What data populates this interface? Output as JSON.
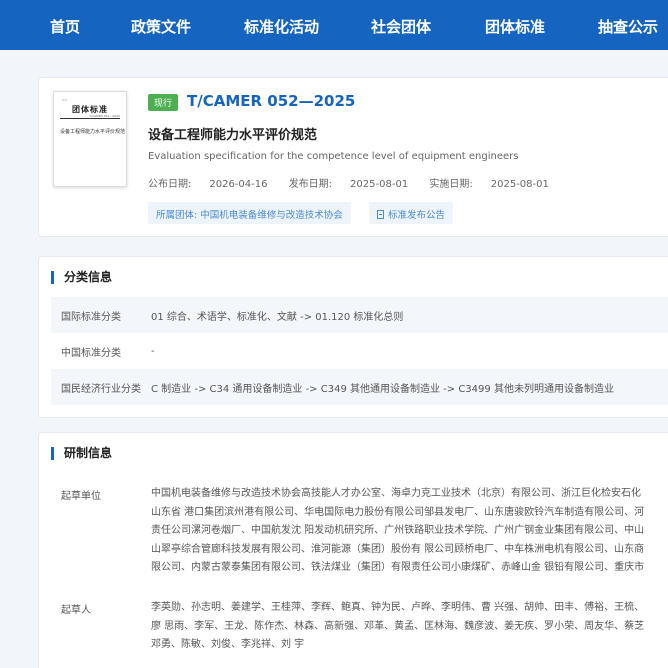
{
  "nav": {
    "items": [
      "首页",
      "政策文件",
      "标准化活动",
      "社会团体",
      "团体标准",
      "抽查公示"
    ]
  },
  "standard": {
    "status": "现行",
    "code": "T/CAMER 052—2025",
    "title": "设备工程师能力水平评价规范",
    "english_title": "Evaluation specification for the competence level of equipment engineers",
    "publish_label": "公布日期:",
    "publish_date": "2026-04-16",
    "release_label": "发布日期:",
    "release_date": "2025-08-01",
    "implement_label": "实施日期:",
    "implement_date": "2025-08-01",
    "org_tag": "所属团体: 中国机电装备维修与改造技术协会",
    "notice_tag": "标准发布公告",
    "cover": {
      "title": "团体标准",
      "name": "设备工程师能力水平评价规范"
    }
  },
  "classification": {
    "heading": "分类信息",
    "rows": [
      {
        "label": "国际标准分类",
        "value": "01 综合、术语学、标准化、文献 -> 01.120 标准化总则"
      },
      {
        "label": "中国标准分类",
        "value": "-"
      },
      {
        "label": "国民经济行业分类",
        "value": "C 制造业 -> C34 通用设备制造业 -> C349 其他通用设备制造业 -> C3499 其他未列明通用设备制造业"
      }
    ]
  },
  "development": {
    "heading": "研制信息",
    "drafting_units_label": "起草单位",
    "drafting_units_lines": [
      "中国机电装备维修与改造技术协会高技能人才办公室、海卓力克工业技术（北京）有限公司、浙江巨化检安石化",
      "山东省 港口集团滨州港有限公司、华电国际电力股份有限公司邹县发电厂、山东唐骏欧铃汽车制造有限公司、河",
      "责任公司漯河卷烟厂、中国航发沈 阳发动机研究所、广州铁路职业技术学院、广州广钢金业集团有限公司、中山",
      "山翠亭综合管廊科技发展有限公司、淮河能源（集团）股份有 限公司顾桥电厂、中车株洲电机有限公司、山东商",
      "限公司、内蒙古蒙泰集团有限公司、铁法煤业（集团）有限责任公司小康煤矿、赤峰山金 银铅有限公司、重庆市"
    ],
    "drafters_label": "起草人",
    "drafters_lines": [
      "李英勋、孙志明、姜建学、王桂萍、李辉、鲍真、钟为民、卢晔、李明伟、曹 兴强、胡帅、田丰、傅裕、王梳、",
      "廖 思雨、李军、王龙、陈作杰、林森、高新强、邓革、黄孟、匡林海、魏彦波、姜无疾、罗小荣、周友华、蔡芝",
      "邓勇、陈敏、刘俊、李兆祥、刘 宇"
    ]
  }
}
